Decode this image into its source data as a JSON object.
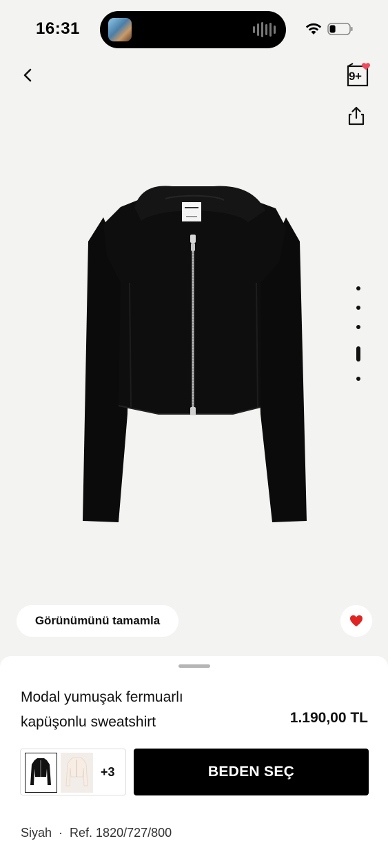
{
  "status_bar": {
    "time": "16:31",
    "island_icon": "now-playing-thumbnail",
    "wifi_icon": "wifi-icon",
    "battery_icon": "battery-icon",
    "battery_level": 0.3
  },
  "header": {
    "back_icon": "chevron-left-icon",
    "alerts_badge": "9+",
    "alerts_dot_color": "#ef4b5f",
    "share_icon": "share-icon"
  },
  "gallery": {
    "image_subject": "black zip-up hooded cropped sweatshirt",
    "page_count": 5,
    "active_page": 4
  },
  "actions": {
    "complete_look_label": "Görünümünü tamamla",
    "wishlist_icon": "heart-icon",
    "wishlist_color": "#e02424"
  },
  "product": {
    "title_line1": "Modal yumuşak fermuarlı",
    "title_line2": "kapüşonlu sweatshirt",
    "price": "1.190,00 TL",
    "colors_more": "+3",
    "size_button_label": "BEDEN SEÇ",
    "color_name": "Siyah",
    "separator": "·",
    "reference": "Ref. 1820/727/800"
  }
}
